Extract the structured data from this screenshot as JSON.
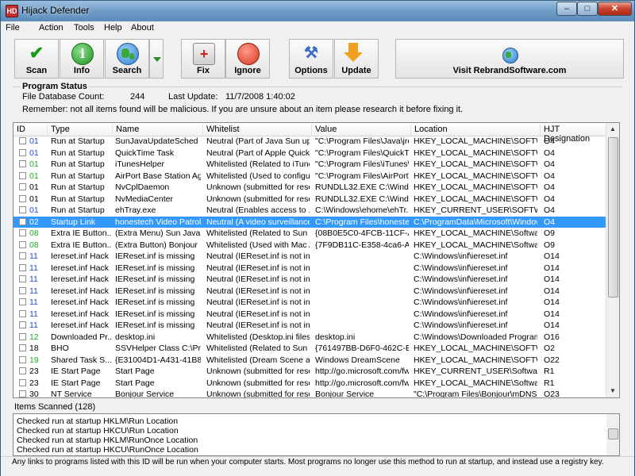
{
  "window": {
    "title": "Hijack Defender",
    "app_icon": "HD"
  },
  "menu": [
    "File",
    "Action",
    "Tools",
    "Help",
    "About"
  ],
  "toolbar": {
    "scan": "Scan",
    "info": "Info",
    "search": "Search",
    "fix": "Fix",
    "ignore": "Ignore",
    "options": "Options",
    "update": "Update",
    "visit": "Visit RebrandSoftware.com"
  },
  "program_status": {
    "heading": "Program Status",
    "db_label": "File Database Count:",
    "db_count": "244",
    "update_label": "Last Update:",
    "update_value": "11/7/2008 1:40:02",
    "remember": "Remember:  not all items found will be malicious.  If you are unsure about an item please research it before fixing it."
  },
  "columns": [
    "ID",
    "Type",
    "Name",
    "Whitelist",
    "Value",
    "Location",
    "HJT Designation"
  ],
  "rows": [
    {
      "id": "01",
      "type": "Run at Startup",
      "name": "SunJavaUpdateSched",
      "whitelist": "Neutral (Part of Java Sun upd...",
      "value": "\"C:\\Program Files\\Java\\jre...",
      "location": "HKEY_LOCAL_MACHINE\\SOFTW...",
      "hjt": "O4",
      "idcolor": "#1e4bd6"
    },
    {
      "id": "01",
      "type": "Run at Startup",
      "name": "QuickTime Task",
      "whitelist": "Neutral (Part of Apple Quickti...",
      "value": "\"C:\\Program Files\\QuickTi...",
      "location": "HKEY_LOCAL_MACHINE\\SOFTW...",
      "hjt": "O4",
      "idcolor": "#1e4bd6"
    },
    {
      "id": "01",
      "type": "Run at Startup",
      "name": "iTunesHelper",
      "whitelist": "Whitelisted (Related to iTune...",
      "value": "\"C:\\Program Files\\iTunes\\i...",
      "location": "HKEY_LOCAL_MACHINE\\SOFTW...",
      "hjt": "O4",
      "idcolor": "#22aa22"
    },
    {
      "id": "01",
      "type": "Run at Startup",
      "name": "AirPort Base Station Ag...",
      "whitelist": "Whitelisted (Used to configur...",
      "value": "\"C:\\Program Files\\AirPort\\...",
      "location": "HKEY_LOCAL_MACHINE\\SOFTW...",
      "hjt": "O4",
      "idcolor": "#22aa22"
    },
    {
      "id": "01",
      "type": "Run at Startup",
      "name": "NvCplDaemon",
      "whitelist": "Unknown (submitted for rese...",
      "value": "RUNDLL32.EXE C:\\Windo...",
      "location": "HKEY_LOCAL_MACHINE\\SOFTW...",
      "hjt": "O4",
      "idcolor": "#000000"
    },
    {
      "id": "01",
      "type": "Run at Startup",
      "name": "NvMediaCenter",
      "whitelist": "Unknown (submitted for rese...",
      "value": "RUNDLL32.EXE C:\\Windo...",
      "location": "HKEY_LOCAL_MACHINE\\SOFTW...",
      "hjt": "O4",
      "idcolor": "#000000"
    },
    {
      "id": "01",
      "type": "Run at Startup",
      "name": "ehTray.exe",
      "whitelist": "Neutral (Enables access to ...",
      "value": "C:\\Windows\\ehome\\ehTr...",
      "location": "HKEY_CURRENT_USER\\SOFTW...",
      "hjt": "O4",
      "idcolor": "#1e4bd6"
    },
    {
      "id": "02",
      "type": "Startup Link",
      "name": "honestech Video Patrol ...",
      "whitelist": "Neutral (A video surveillance ...",
      "value": "C:\\Program Files\\honestec...",
      "location": "C:\\ProgramData\\Microsoft\\Window...",
      "hjt": "O4",
      "idcolor": "#ffffff",
      "selected": true
    },
    {
      "id": "08",
      "type": "Extra IE Button...",
      "name": "(Extra Menu) Sun Java ...",
      "whitelist": "Whitelisted (Related to Sun J...",
      "value": "{08B0E5C0-4FCB-11CF-A...",
      "location": "HKEY_LOCAL_MACHINE\\Software...",
      "hjt": "O9",
      "idcolor": "#22aa22"
    },
    {
      "id": "08",
      "type": "Extra IE Button...",
      "name": "(Extra Button) Bonjour",
      "whitelist": "Whitelisted (Used with Mac A...",
      "value": "{7F9DB11C-E358-4ca6-A8...",
      "location": "HKEY_LOCAL_MACHINE\\Software...",
      "hjt": "O9",
      "idcolor": "#22aa22"
    },
    {
      "id": "11",
      "type": "Iereset.inf Hack",
      "name": "IEReset.inf is missing",
      "whitelist": "Neutral (IEReset.inf is not incl...",
      "value": "",
      "location": "C:\\Windows\\inf\\iereset.inf",
      "hjt": "O14",
      "idcolor": "#1e4bd6"
    },
    {
      "id": "11",
      "type": "Iereset.inf Hack",
      "name": "IEReset.inf is missing",
      "whitelist": "Neutral (IEReset.inf is not incl...",
      "value": "",
      "location": "C:\\Windows\\inf\\iereset.inf",
      "hjt": "O14",
      "idcolor": "#1e4bd6"
    },
    {
      "id": "11",
      "type": "Iereset.inf Hack",
      "name": "IEReset.inf is missing",
      "whitelist": "Neutral (IEReset.inf is not incl...",
      "value": "",
      "location": "C:\\Windows\\inf\\iereset.inf",
      "hjt": "O14",
      "idcolor": "#1e4bd6"
    },
    {
      "id": "11",
      "type": "Iereset.inf Hack",
      "name": "IEReset.inf is missing",
      "whitelist": "Neutral (IEReset.inf is not incl...",
      "value": "",
      "location": "C:\\Windows\\inf\\iereset.inf",
      "hjt": "O14",
      "idcolor": "#1e4bd6"
    },
    {
      "id": "11",
      "type": "Iereset.inf Hack",
      "name": "IEReset.inf is missing",
      "whitelist": "Neutral (IEReset.inf is not incl...",
      "value": "",
      "location": "C:\\Windows\\inf\\iereset.inf",
      "hjt": "O14",
      "idcolor": "#1e4bd6"
    },
    {
      "id": "11",
      "type": "Iereset.inf Hack",
      "name": "IEReset.inf is missing",
      "whitelist": "Neutral (IEReset.inf is not incl...",
      "value": "",
      "location": "C:\\Windows\\inf\\iereset.inf",
      "hjt": "O14",
      "idcolor": "#1e4bd6"
    },
    {
      "id": "11",
      "type": "Iereset.inf Hack",
      "name": "IEReset.inf is missing",
      "whitelist": "Neutral (IEReset.inf is not incl...",
      "value": "",
      "location": "C:\\Windows\\inf\\iereset.inf",
      "hjt": "O14",
      "idcolor": "#1e4bd6"
    },
    {
      "id": "12",
      "type": "Downloaded Pr...",
      "name": "desktop.ini",
      "whitelist": "Whitelisted (Desktop.ini files s...",
      "value": "desktop.ini",
      "location": "C:\\Windows\\Downloaded Program ...",
      "hjt": "O16",
      "idcolor": "#22aa22"
    },
    {
      "id": "18",
      "type": "BHO",
      "name": "SSVHelper Class C:\\Pro...",
      "whitelist": "Whitelisted (Related to Sun J...",
      "value": "{761497BB-D6F0-462C-B6...",
      "location": "HKEY_LOCAL_MACHINE\\SOFTW...",
      "hjt": "O2",
      "idcolor": "#000000"
    },
    {
      "id": "19",
      "type": "Shared Task S...",
      "name": "{E31004D1-A431-41B8-...",
      "whitelist": "Whitelisted (Dream Scene all...",
      "value": "Windows DreamScene",
      "location": "HKEY_LOCAL_MACHINE\\SOFTW...",
      "hjt": "O22",
      "idcolor": "#22aa22"
    },
    {
      "id": "23",
      "type": "IE Start Page",
      "name": "Start Page",
      "whitelist": "Unknown (submitted for rese...",
      "value": "http://go.microsoft.com/fw...",
      "location": "HKEY_CURRENT_USER\\Software...",
      "hjt": "R1",
      "idcolor": "#000000"
    },
    {
      "id": "23",
      "type": "IE Start Page",
      "name": "Start Page",
      "whitelist": "Unknown (submitted for rese...",
      "value": "http://go.microsoft.com/fw...",
      "location": "HKEY_LOCAL_MACHINE\\Software...",
      "hjt": "R1",
      "idcolor": "#000000"
    },
    {
      "id": "30",
      "type": "NT Service",
      "name": "Bonjour Service",
      "whitelist": "Unknown (submitted for rese...",
      "value": "Bonjour Service",
      "location": "\"C:\\Program Files\\Bonjour\\mDNSR...",
      "hjt": "O23",
      "idcolor": "#000000"
    }
  ],
  "items_scanned": "Items Scanned (128)",
  "log": [
    "Checked run at startup HKLM\\Run Location",
    "Checked run at startup HKCU\\Run Location",
    "Checked run at startup HKLM\\RunOnce Location",
    "Checked run at startup HKCU\\RunOnce Location"
  ],
  "status_text": "Any links to programs listed with this ID will be run when your computer starts.  Most programs no longer use this method to run at startup, and instead use a registry key."
}
